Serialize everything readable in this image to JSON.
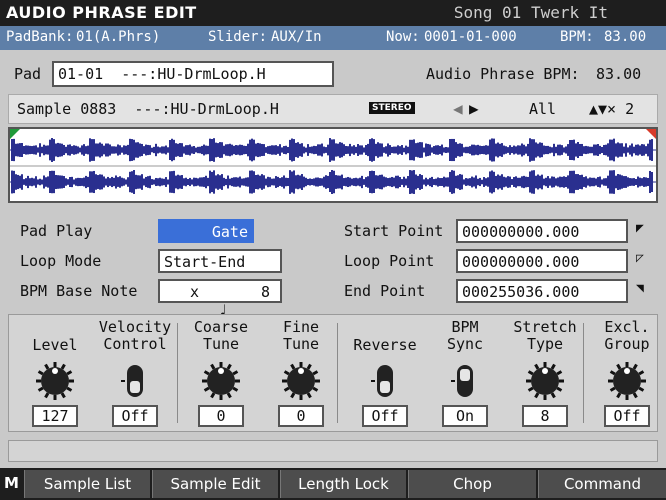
{
  "title": "AUDIO PHRASE EDIT",
  "song": "Song 01 Twerk  It",
  "status": {
    "padbank_label": "PadBank:",
    "padbank_value": "01(A.Phrs)",
    "slider_label": "Slider:",
    "slider_value": "AUX/In",
    "now_label": "Now:",
    "now_value": "0001-01-000",
    "bpm_label": "BPM:",
    "bpm_value": "83.00"
  },
  "pad": {
    "label": "Pad",
    "value": "01-01  ---:HU-DrmLoop.H",
    "phrase_bpm_label": "Audio Phrase BPM:",
    "phrase_bpm_value": "83.00"
  },
  "sample": {
    "name": "Sample 0883  ---:HU-DrmLoop.H",
    "badge": "STEREO",
    "zoom_mode": "All",
    "zoom_factor": "▲▼× 2"
  },
  "params": {
    "pad_play_label": "Pad Play",
    "pad_play_value": "Gate",
    "loop_mode_label": "Loop Mode",
    "loop_mode_value": "Start-End",
    "bpm_base_note_label": "BPM Base Note",
    "bpm_base_note_symbol": "♩",
    "bpm_base_note_mult": "x",
    "bpm_base_note_value": "8",
    "start_point_label": "Start Point",
    "start_point_value": "000000000.000",
    "loop_point_label": "Loop Point",
    "loop_point_value": "000000000.000",
    "end_point_label": "End Point",
    "end_point_value": "000255036.000"
  },
  "knobs": [
    {
      "caption": "Level",
      "value": "127"
    },
    {
      "caption": "Velocity\nControl",
      "value": "Off"
    },
    {
      "caption": "Coarse\nTune",
      "value": "0"
    },
    {
      "caption": "Fine\nTune",
      "value": "0"
    },
    {
      "caption": "Reverse",
      "value": "Off"
    },
    {
      "caption": "BPM\nSync",
      "value": "On"
    },
    {
      "caption": "Stretch\nType",
      "value": "8"
    },
    {
      "caption": "Excl.\nGroup",
      "value": "Off"
    }
  ],
  "function_bar": {
    "mode_tag": "M",
    "buttons": [
      "Sample List",
      "Sample Edit",
      "Length Lock",
      "Chop",
      "Command"
    ]
  },
  "colors": {
    "title_bg": "#1e1e1e",
    "status_bg": "#5e7fa8",
    "selected_bg": "#3a6fd8",
    "waveform": "#2a2f8f",
    "start_marker": "#1f9a3a",
    "end_marker": "#d83a2a"
  }
}
